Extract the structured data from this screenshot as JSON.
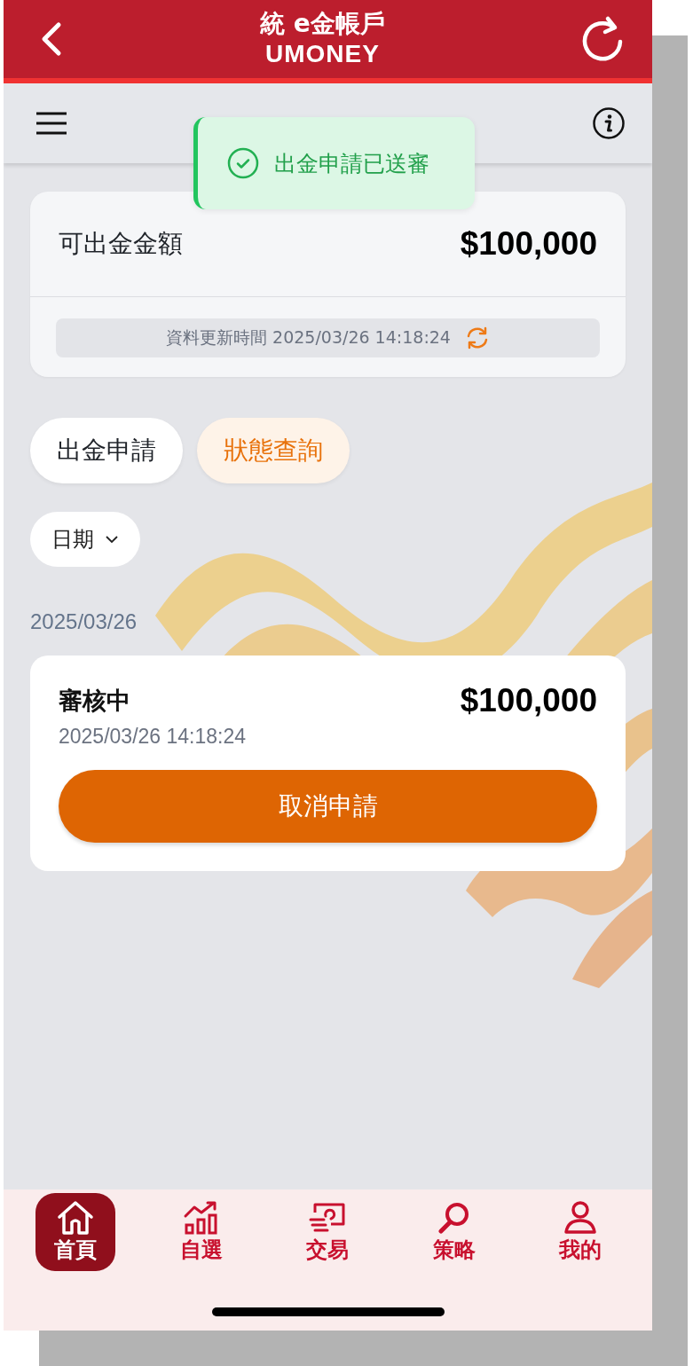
{
  "header": {
    "title": "統 e金帳戶",
    "subtitle": "UMONEY"
  },
  "toast": {
    "message": "出金申請已送審"
  },
  "balance": {
    "label": "可出金金額",
    "amount": "$100,000",
    "updated": "資料更新時間 2025/03/26 14:18:24"
  },
  "tabs": [
    {
      "label": "出金申請",
      "selected": false
    },
    {
      "label": "狀態查詢",
      "selected": true
    }
  ],
  "filter": {
    "label": "日期"
  },
  "groups": [
    {
      "date": "2025/03/26",
      "records": [
        {
          "status": "審核中",
          "amount": "$100,000",
          "time": "2025/03/26 14:18:24",
          "action": "取消申請"
        }
      ]
    }
  ],
  "nav": [
    {
      "label": "首頁",
      "selected": true
    },
    {
      "label": "自選",
      "selected": false
    },
    {
      "label": "交易",
      "selected": false
    },
    {
      "label": "策略",
      "selected": false
    },
    {
      "label": "我的",
      "selected": false
    }
  ]
}
